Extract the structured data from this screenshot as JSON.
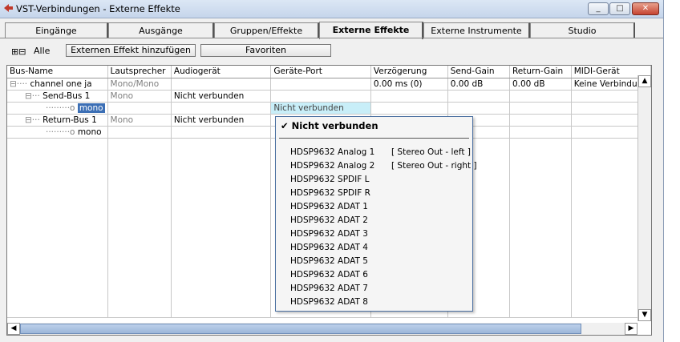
{
  "window": {
    "title": "VST-Verbindungen - Externe Effekte",
    "buttons": [
      "_",
      "□",
      "✕"
    ]
  },
  "tabs": [
    {
      "label": "Eingänge",
      "active": false
    },
    {
      "label": "Ausgänge",
      "active": false
    },
    {
      "label": "Gruppen/Effekte",
      "active": false
    },
    {
      "label": "Externe Effekte",
      "active": true
    },
    {
      "label": "Externe Instrumente",
      "active": false
    },
    {
      "label": "Studio",
      "active": false
    }
  ],
  "toolbar": {
    "expand_icons": "⊞⊟",
    "all_label": "Alle",
    "add_button": "Externen Effekt hinzufügen",
    "favorites_button": "Favoriten"
  },
  "table": {
    "headers": [
      "Bus-Name",
      "Lautsprecher",
      "Audiogerät",
      "Geräte-Port",
      "Verzögerung",
      "Send-Gain",
      "Return-Gain",
      "MIDI-Gerät"
    ],
    "rows": [
      {
        "name": "channel one ja",
        "prefix": "⊟····",
        "speaker": "Mono/Mono",
        "device": "",
        "port": "",
        "delay": "0.00 ms (0)",
        "send": "0.00 dB",
        "return": "0.00 dB",
        "midi": "Keine Verbindung"
      },
      {
        "name": "Send-Bus 1",
        "prefix": "⊟···",
        "speaker": "Mono",
        "device": "Nicht verbunden",
        "port": "",
        "delay": "",
        "send": "",
        "return": "",
        "midi": ""
      },
      {
        "name": "mono",
        "prefix": "·········o",
        "speaker": "",
        "device": "",
        "port": "Nicht verbunden",
        "delay": "",
        "send": "",
        "return": "",
        "midi": ""
      },
      {
        "name": "Return-Bus 1",
        "prefix": "⊟···",
        "speaker": "Mono",
        "device": "Nicht verbunden",
        "port": "",
        "delay": "",
        "send": "",
        "return": "",
        "midi": ""
      },
      {
        "name": "mono",
        "prefix": "·········o",
        "speaker": "",
        "device": "",
        "port": "",
        "delay": "",
        "send": "",
        "return": "",
        "midi": ""
      }
    ]
  },
  "dropdown": {
    "selected": "✔ Nicht verbunden",
    "items": [
      {
        "label": "HDSP9632 Analog 1",
        "extra": "[ Stereo Out - left ]"
      },
      {
        "label": "HDSP9632 Analog 2",
        "extra": "[ Stereo Out - right ]"
      },
      {
        "label": "HDSP9632 SPDIF L",
        "extra": ""
      },
      {
        "label": "HDSP9632 SPDIF R",
        "extra": ""
      },
      {
        "label": "HDSP9632 ADAT 1",
        "extra": ""
      },
      {
        "label": "HDSP9632 ADAT 2",
        "extra": ""
      },
      {
        "label": "HDSP9632 ADAT 3",
        "extra": ""
      },
      {
        "label": "HDSP9632 ADAT 4",
        "extra": ""
      },
      {
        "label": "HDSP9632 ADAT 5",
        "extra": ""
      },
      {
        "label": "HDSP9632 ADAT 6",
        "extra": ""
      },
      {
        "label": "HDSP9632 ADAT 7",
        "extra": ""
      },
      {
        "label": "HDSP9632 ADAT 8",
        "extra": ""
      }
    ]
  },
  "scroll": {
    "up": "▲",
    "down": "▼",
    "left": "◀",
    "right": "▶"
  }
}
